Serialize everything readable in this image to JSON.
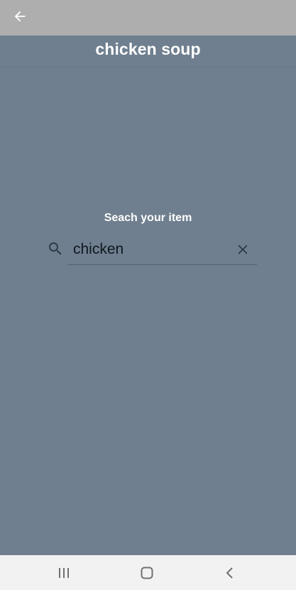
{
  "topbar": {
    "back_icon": "arrow-left-icon"
  },
  "header": {
    "title": "chicken soup"
  },
  "search": {
    "label": "Seach your item",
    "value": "chicken",
    "search_icon": "search-icon",
    "clear_icon": "close-icon"
  },
  "navbar": {
    "recents_icon": "recent-apps-icon",
    "home_icon": "home-icon",
    "back_icon": "chevron-left-icon"
  },
  "colors": {
    "background": "#6f7f8f",
    "topbar": "#aeaeae",
    "navbar": "#f2f2f2",
    "title_text": "#ffffff"
  }
}
